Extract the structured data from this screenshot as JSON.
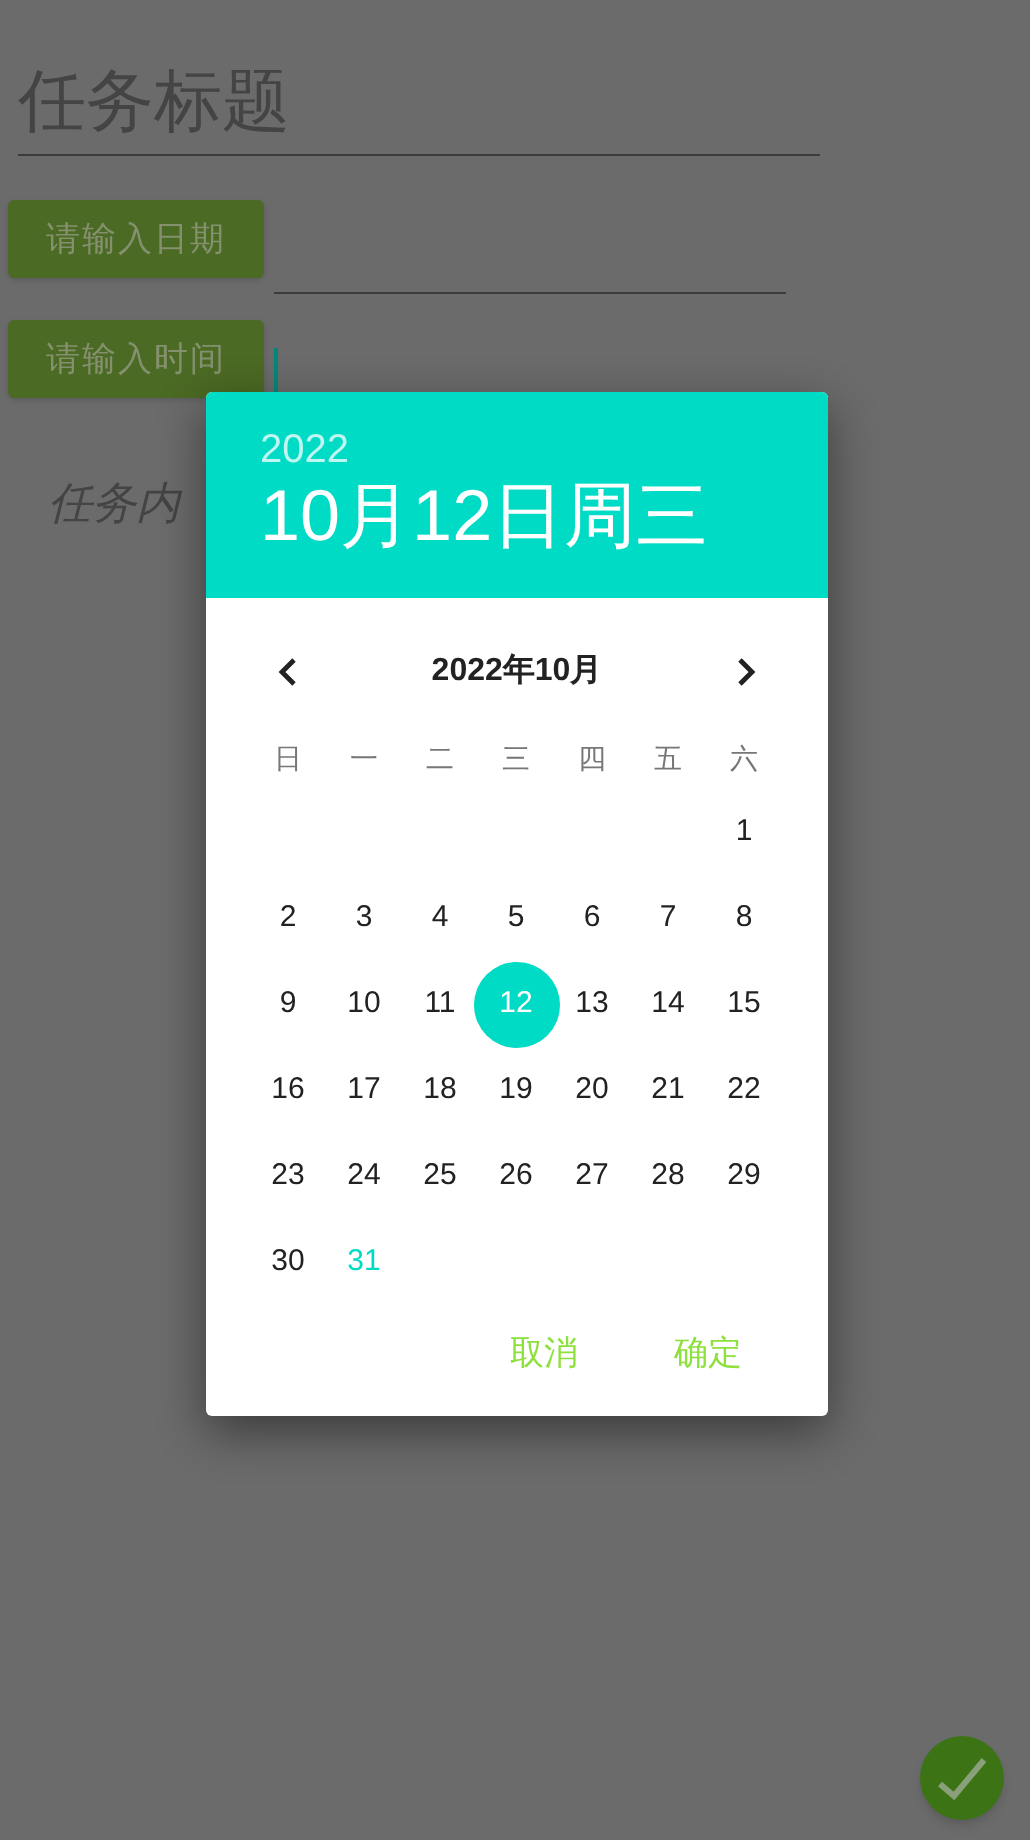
{
  "form": {
    "title_field": {
      "placeholder": "任务标题"
    },
    "date_button": "请输入日期",
    "time_button": "请输入时间",
    "content_field": {
      "placeholder": "任务内"
    }
  },
  "date_picker": {
    "year": "2022",
    "date": "10月12日周三",
    "month_label": "2022年10月",
    "weekdays": [
      "日",
      "一",
      "二",
      "三",
      "四",
      "五",
      "六"
    ],
    "weeks": [
      {
        "days": [
          {
            "label": "1",
            "selected": false,
            "today": false
          }
        ]
      },
      {
        "days": [
          {
            "label": "2",
            "selected": false,
            "today": false
          },
          {
            "label": "3",
            "selected": false,
            "today": false
          },
          {
            "label": "4",
            "selected": false,
            "today": false
          },
          {
            "label": "5",
            "selected": false,
            "today": false
          },
          {
            "label": "6",
            "selected": false,
            "today": false
          },
          {
            "label": "7",
            "selected": false,
            "today": false
          },
          {
            "label": "8",
            "selected": false,
            "today": false
          }
        ]
      },
      {
        "days": [
          {
            "label": "9",
            "selected": false,
            "today": false
          },
          {
            "label": "10",
            "selected": false,
            "today": false
          },
          {
            "label": "11",
            "selected": false,
            "today": false
          },
          {
            "label": "12",
            "selected": true,
            "today": false
          },
          {
            "label": "13",
            "selected": false,
            "today": false
          },
          {
            "label": "14",
            "selected": false,
            "today": false
          },
          {
            "label": "15",
            "selected": false,
            "today": false
          }
        ]
      },
      {
        "days": [
          {
            "label": "16",
            "selected": false,
            "today": false
          },
          {
            "label": "17",
            "selected": false,
            "today": false
          },
          {
            "label": "18",
            "selected": false,
            "today": false
          },
          {
            "label": "19",
            "selected": false,
            "today": false
          },
          {
            "label": "20",
            "selected": false,
            "today": false
          },
          {
            "label": "21",
            "selected": false,
            "today": false
          },
          {
            "label": "22",
            "selected": false,
            "today": false
          }
        ]
      },
      {
        "days": [
          {
            "label": "23",
            "selected": false,
            "today": false
          },
          {
            "label": "24",
            "selected": false,
            "today": false
          },
          {
            "label": "25",
            "selected": false,
            "today": false
          },
          {
            "label": "26",
            "selected": false,
            "today": false
          },
          {
            "label": "27",
            "selected": false,
            "today": false
          },
          {
            "label": "28",
            "selected": false,
            "today": false
          },
          {
            "label": "29",
            "selected": false,
            "today": false
          }
        ]
      },
      {
        "days": [
          {
            "label": "30",
            "selected": false,
            "today": false
          },
          {
            "label": "31",
            "selected": false,
            "today": true
          }
        ]
      }
    ],
    "buttons": [
      "取消",
      "确定"
    ]
  }
}
